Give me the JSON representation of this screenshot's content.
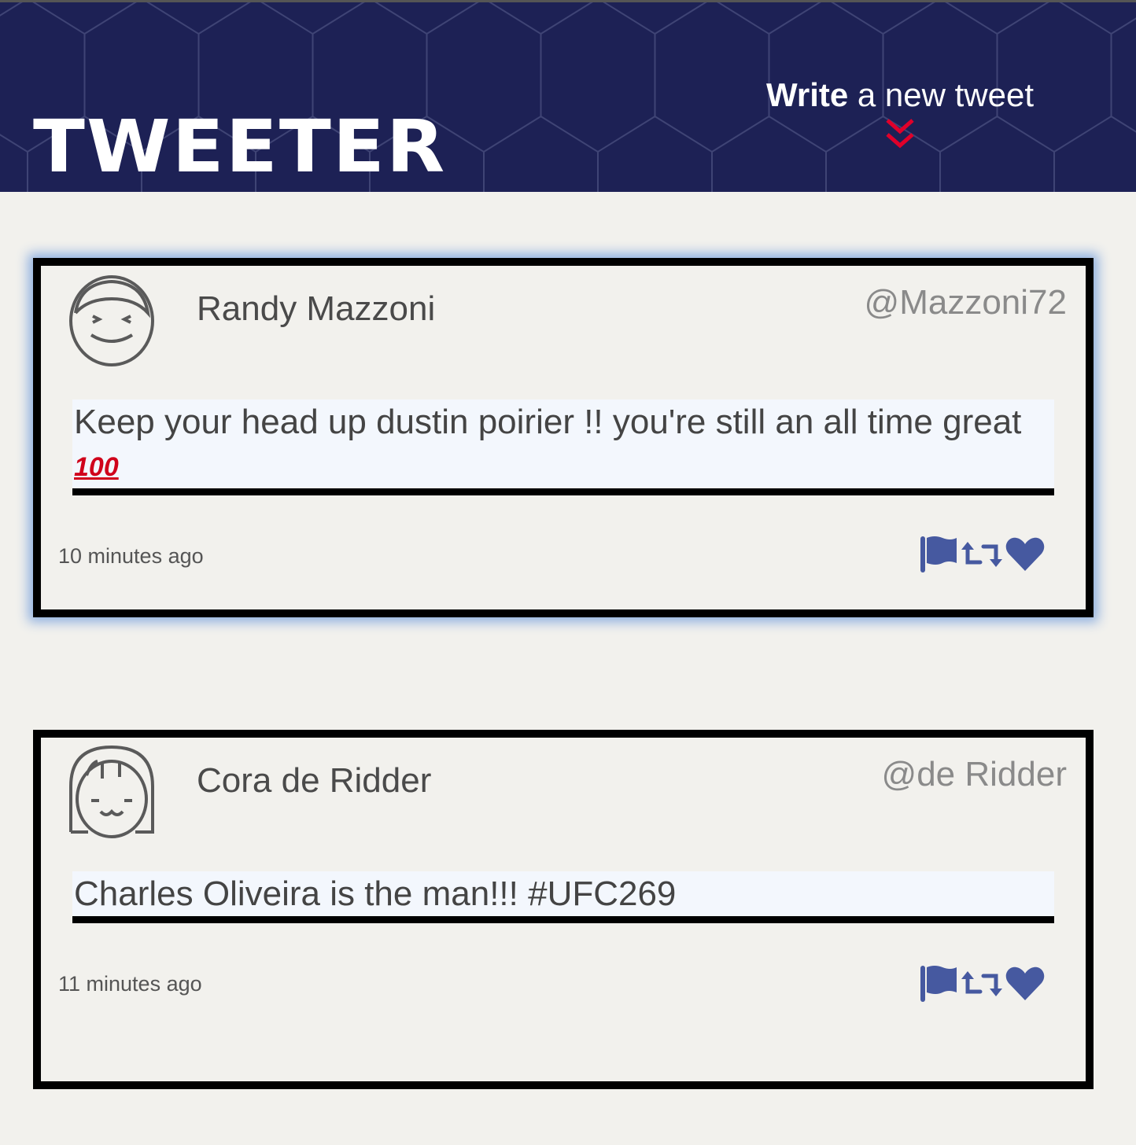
{
  "header": {
    "logo": "TWEETER",
    "compose_bold": "Write",
    "compose_rest": " a new tweet"
  },
  "colors": {
    "header_bg": "#1d2155",
    "accent": "#e0002a",
    "icon": "#4659a0"
  },
  "tweets": [
    {
      "name": "Randy Mazzoni",
      "handle": "@Mazzoni72",
      "text": "Keep your head up dustin poirier !! you're still an all time great",
      "emoji": "100",
      "time": "10 minutes ago"
    },
    {
      "name": "Cora de Ridder",
      "handle": "@de Ridder",
      "text": "Charles Oliveira is the man!!! #UFC269",
      "time": "11 minutes ago"
    }
  ]
}
